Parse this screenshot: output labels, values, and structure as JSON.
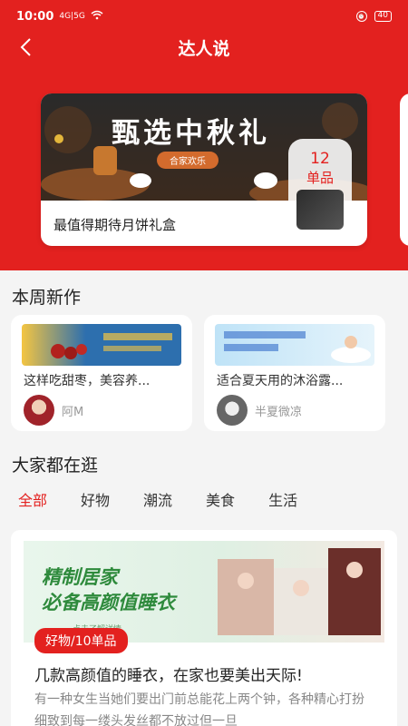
{
  "status_bar": {
    "time": "10:00",
    "signal": "4G|5G",
    "battery": "40"
  },
  "nav": {
    "title": "达人说"
  },
  "hero": {
    "image_title": "甄选中秋礼",
    "image_subtitle": "合家欢乐",
    "caption": "最值得期待月饼礼盒",
    "count_num": "12",
    "count_unit": "单品"
  },
  "weekly": {
    "section_title": "本周新作",
    "cards": [
      {
        "title": "这样吃甜枣，美容养...",
        "author": "阿M"
      },
      {
        "title": "适合夏天用的沐浴露...",
        "author": "半夏微凉"
      }
    ]
  },
  "browse": {
    "section_title": "大家都在逛",
    "tabs": [
      "全部",
      "好物",
      "潮流",
      "美食",
      "生活"
    ],
    "active_tab": "全部"
  },
  "main_card": {
    "image_line1": "精制居家",
    "image_line2": "必备高颜值睡衣",
    "image_hint": "点击了解详情",
    "badge": "好物/10单品",
    "title": "几款高颜值的睡衣，在家也要美出天际!",
    "description": "有一种女生当她们要出门前总能花上两个钟，各种精心打扮细致到每一缕头发丝都不放过但一旦"
  },
  "colors": {
    "brand_red": "#e3211f",
    "background": "#f4f4f4"
  }
}
